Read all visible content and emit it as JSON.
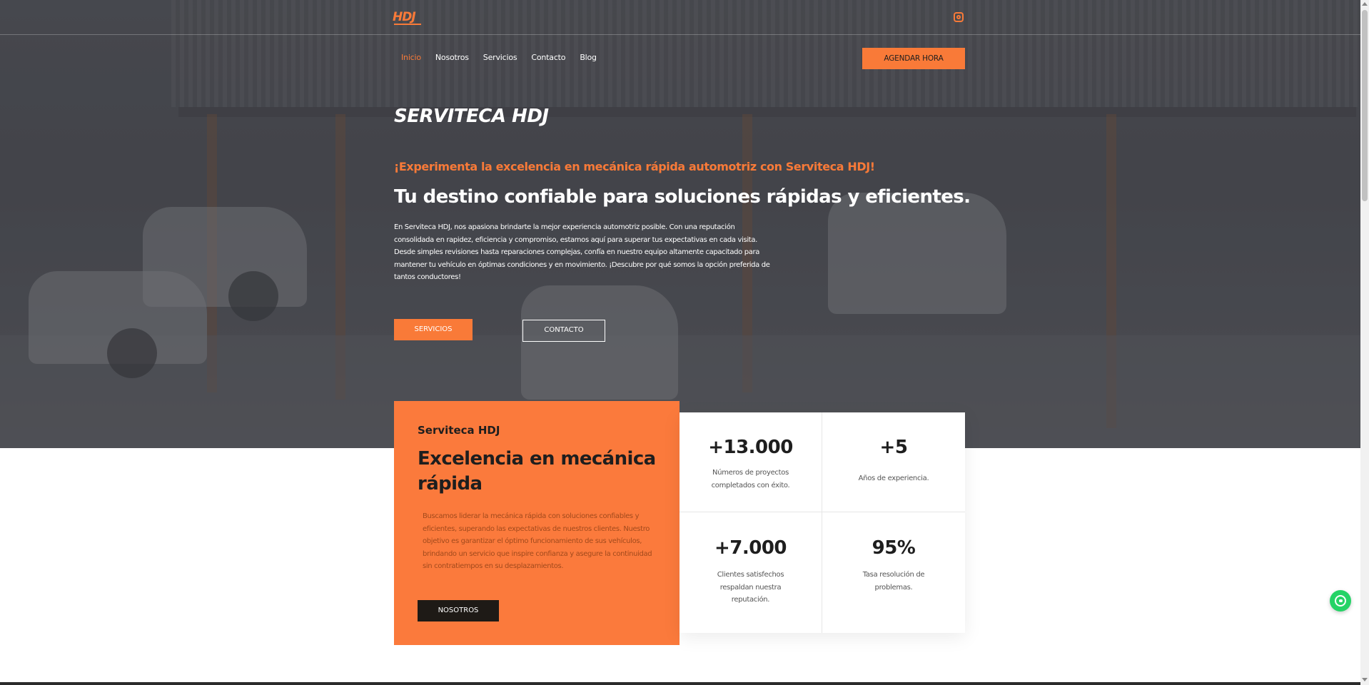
{
  "header": {
    "logo_text": "HDJ",
    "instagram_icon": "instagram-icon"
  },
  "nav": {
    "items": [
      "Inicio",
      "Nosotros",
      "Servicios",
      "Contacto",
      "Blog"
    ],
    "active": "Inicio",
    "cta": "AGENDAR HORA"
  },
  "hero": {
    "title": "SERVITECA HDJ",
    "tagline": "¡Experimenta la excelencia en mecánica rápida automotriz con Serviteca HDJ!",
    "subtitle": "Tu destino confiable para soluciones rápidas y eficientes.",
    "body_lines": [
      " En Serviteca HDJ, nos apasiona brindarte la mejor experiencia automotriz posible. Con una reputación",
      "consolidada en rapidez, eficiencia y compromiso, estamos aquí para superar tus expectativas en cada visita.",
      "Desde simples revisiones hasta reparaciones complejas, confía en nuestro equipo altamente capacitado para",
      "mantener tu vehículo en óptimas condiciones y en movimiento. ¡Descubre por qué somos la opción preferida de",
      "tantos conductores!"
    ],
    "btn_servicios": "SERVICIOS",
    "btn_contacto": "CONTACTO"
  },
  "about_card": {
    "eyebrow": "Serviteca HDJ",
    "title": "Excelencia en mecánica rápida",
    "body": "Buscamos liderar la mecánica rápida con soluciones confiables y eficientes, superando las expectativas de nuestros clientes. Nuestro objetivo es garantizar el óptimo funcionamiento de sus vehículos, brindando un servicio que inspire confianza y asegure la continuidad sin contratiempos en su desplazamientos.",
    "button": "NOSOTROS"
  },
  "stats": [
    {
      "value": "+13.000",
      "label": "Números de proyectos completados con éxito."
    },
    {
      "value": "+5",
      "label": "Años de experiencia."
    },
    {
      "value": "+7.000",
      "label": "Clientes satisfechos respaldan nuestra reputación."
    },
    {
      "value": "95%",
      "label": "Tasa resolución de problemas."
    }
  ],
  "floating": {
    "whatsapp_icon": "whatsapp-icon"
  },
  "colors": {
    "accent": "#f97a38",
    "dark": "#1e1e1e",
    "whatsapp": "#25d366"
  }
}
